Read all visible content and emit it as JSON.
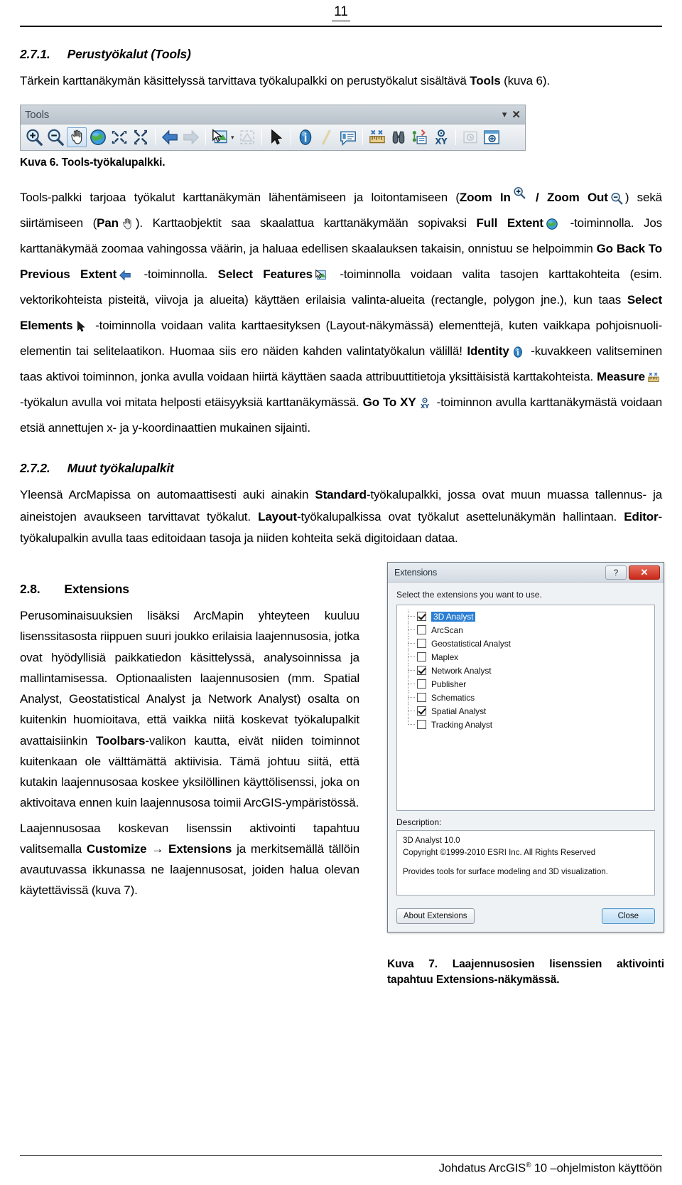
{
  "header": {
    "page_number": "11"
  },
  "section_271": {
    "number": "2.7.1.",
    "title": "Perustyökalut (Tools)",
    "intro_pre": "Tärkein karttanäkymän käsittelyssä tarvittava työkalupalkki on perustyökalut sisältävä ",
    "intro_bold": "Tools",
    "intro_post": " (kuva 6)."
  },
  "toolbar": {
    "title": "Tools",
    "collapse_glyph": "▾",
    "close_glyph": "✕",
    "buttons": [
      {
        "name": "zoom-in-icon",
        "tooltip": "Zoom In"
      },
      {
        "name": "zoom-out-icon",
        "tooltip": "Zoom Out"
      },
      {
        "name": "pan-hand-icon",
        "tooltip": "Pan"
      },
      {
        "name": "full-extent-globe-icon",
        "tooltip": "Full Extent"
      },
      {
        "name": "fixed-zoom-in-icon",
        "tooltip": "Fixed Zoom In"
      },
      {
        "name": "fixed-zoom-out-icon",
        "tooltip": "Fixed Zoom Out"
      },
      {
        "name": "go-back-previous-extent-icon",
        "tooltip": "Go Back To Previous Extent"
      },
      {
        "name": "go-forward-next-extent-icon",
        "tooltip": "Go To Next Extent"
      },
      {
        "name": "select-features-icon",
        "tooltip": "Select Features"
      },
      {
        "name": "clear-selected-features-icon",
        "tooltip": "Clear Selected Features"
      },
      {
        "name": "select-elements-arrow-icon",
        "tooltip": "Select Elements"
      },
      {
        "name": "identify-icon",
        "tooltip": "Identify"
      },
      {
        "name": "hyperlink-icon",
        "tooltip": "Hyperlink"
      },
      {
        "name": "html-popup-icon",
        "tooltip": "HTML Popup"
      },
      {
        "name": "measure-icon",
        "tooltip": "Measure"
      },
      {
        "name": "find-binoculars-icon",
        "tooltip": "Find"
      },
      {
        "name": "find-route-icon",
        "tooltip": "Find Route"
      },
      {
        "name": "go-to-xy-icon",
        "tooltip": "Go To XY"
      },
      {
        "name": "time-slider-icon",
        "tooltip": "Time Slider"
      },
      {
        "name": "create-viewer-window-icon",
        "tooltip": "Create Viewer Window"
      }
    ]
  },
  "figure6": {
    "caption": "Kuva 6. Tools-työkalupalkki."
  },
  "paragraph_tools": {
    "t1": "Tools-palkki tarjoaa työkalut karttanäkymän lähentämiseen ja loitontamiseen (",
    "b_zoom_in": "Zoom In",
    "t2": " / ",
    "b_zoom_out": "Zoom Out",
    "t3": ") sekä siirtämiseen (",
    "b_pan": "Pan",
    "t4": "). Karttaobjektit saa skaalattua karttanäkymään sopivaksi ",
    "b_full_extent": "Full Extent",
    "t5": " -toiminnolla. Jos karttanäkymää zoomaa vahingossa väärin, ja haluaa edellisen skaalauksen takaisin, onnistuu se helpoimmin ",
    "b_go_back": "Go Back To Previous Extent",
    "t6": " -toiminnolla. ",
    "b_select_features": "Select Features",
    "t7": " -toiminnolla voidaan valita tasojen karttakohteita (esim. vektorikohteista pisteitä, viivoja ja alueita) käyttäen erilaisia valinta-alueita (rectangle, polygon jne.), kun taas ",
    "b_select_elements": "Select Elements",
    "t8": " -toiminnolla voidaan valita karttaesityksen (Layout-näkymässä) elementtejä, kuten vaikkapa pohjoisnuoli-elementin tai selitelaatikon. Huomaa siis ero näiden kahden valintatyökalun välillä!",
    "b_identity": "Identity",
    "t9": " -kuvakkeen valitseminen taas aktivoi toiminnon, jonka avulla voidaan hiirtä käyttäen saada attribuuttitietoja yksittäisistä karttakohteista. ",
    "b_measure": "Measure",
    "t10": " -työkalun avulla voi mitata helposti etäisyyksiä karttanäkymässä. ",
    "b_go_to_xy": "Go To XY",
    "t11": " -toiminnon avulla karttanäkymästä voidaan etsiä annettujen x- ja y-koordinaattien mukainen sijainti."
  },
  "section_272": {
    "number": "2.7.2.",
    "title": "Muut työkalupalkit",
    "t1": "Yleensä ArcMapissa on automaattisesti auki ainakin ",
    "b1": "Standard",
    "t2": "-työkalupalkki, jossa ovat muun muassa tallennus- ja aineistojen avaukseen tarvittavat työkalut. ",
    "b2": "Layout",
    "t3": "-työkalupalkissa ovat työkalut asettelunäkymän hallintaan. ",
    "b3": "Editor",
    "t4": "-työkalupalkin avulla taas editoidaan tasoja ja niiden kohteita sekä digitoidaan dataa."
  },
  "section_28": {
    "number": "2.8.",
    "title": "Extensions",
    "p1": "Perusominaisuuksien lisäksi ArcMapin yhteyteen kuuluu lisenssitasosta riippuen suuri joukko erilaisia laajennusosia, jotka ovat hyödyllisiä paikkatiedon käsittelyssä, analysoinnissa ja mallintamisessa. Optionaalisten laajennusosien (mm. Spatial Analyst, Geostatistical Analyst ja Network Analyst) osalta on kuitenkin huomioitava, että vaikka niitä koskevat työkalupalkit avattaisiinkin ",
    "p1_bold": "Toolbars",
    "p1_post": "-valikon kautta, eivät niiden toiminnot kuitenkaan ole välttämättä aktiivisia. Tämä johtuu siitä, että kutakin laajennusosaa koskee yksilöllinen käyttölisenssi, joka on aktivoitava ennen kuin laajennusosa toimii ArcGIS-ympäristössä.",
    "p2_pre": "Laajennusosaa koskevan lisenssin aktivointi tapahtuu valitsemalla ",
    "p2_bold": "Customize → Extensions",
    "p2_post": " ja merkitsemällä tällöin avautuvassa ikkunassa ne laajennusosat, joiden halua olevan käytettävissä (kuva 7)."
  },
  "extensions_dialog": {
    "title": "Extensions",
    "help_glyph": "?",
    "close_glyph": "✕",
    "prompt": "Select the extensions you want to use.",
    "items": [
      {
        "label": "3D Analyst",
        "checked": true,
        "selected": true
      },
      {
        "label": "ArcScan",
        "checked": false,
        "selected": false
      },
      {
        "label": "Geostatistical Analyst",
        "checked": false,
        "selected": false
      },
      {
        "label": "Maplex",
        "checked": false,
        "selected": false
      },
      {
        "label": "Network Analyst",
        "checked": true,
        "selected": false
      },
      {
        "label": "Publisher",
        "checked": false,
        "selected": false
      },
      {
        "label": "Schematics",
        "checked": false,
        "selected": false
      },
      {
        "label": "Spatial Analyst",
        "checked": true,
        "selected": false
      },
      {
        "label": "Tracking Analyst",
        "checked": false,
        "selected": false
      }
    ],
    "description_label": "Description:",
    "description_line1": "3D Analyst 10.0",
    "description_line2": "Copyright ©1999-2010 ESRI Inc. All Rights Reserved",
    "description_line3": "Provides tools for surface modeling and 3D visualization.",
    "about_button": "About Extensions",
    "close_button": "Close"
  },
  "figure7": {
    "caption": "Kuva 7. Laajennusosien lisenssien aktivointi tapahtuu Extensions-näkymässä."
  },
  "footer": {
    "text_pre": "Johdatus ArcGIS",
    "registered": "®",
    "text_post": " 10 –ohjelmiston käyttöön"
  }
}
